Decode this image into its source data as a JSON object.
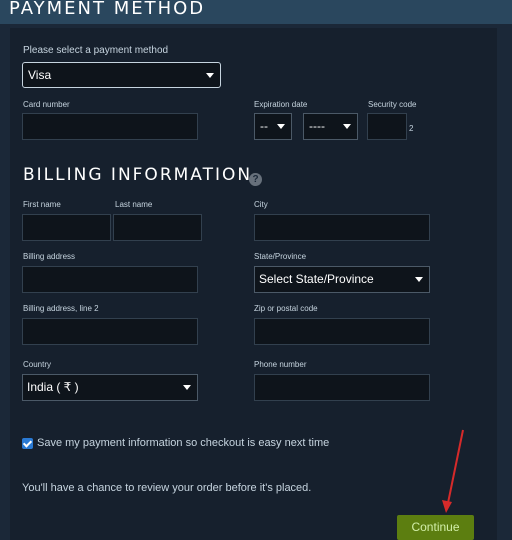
{
  "header": {
    "title": "PAYMENT METHOD"
  },
  "payment": {
    "select_label": "Please select a payment method",
    "method_value": "Visa",
    "card_number_label": "Card number",
    "expiration_label": "Expiration date",
    "exp_month": "--",
    "exp_year": "----",
    "security_code_label": "Security code",
    "security_hint": "2"
  },
  "billing": {
    "title": "BILLING INFORMATION",
    "help_icon": "?",
    "first_name_label": "First name",
    "last_name_label": "Last name",
    "city_label": "City",
    "address_label": "Billing address",
    "state_label": "State/Province",
    "state_value": "Select State/Province",
    "address2_label": "Billing address, line 2",
    "zip_label": "Zip or postal code",
    "country_label": "Country",
    "country_value": "India ( ₹ )",
    "phone_label": "Phone number"
  },
  "save_info": {
    "checked": true,
    "label": "Save my payment information so checkout is easy next time"
  },
  "review_note": "You'll have a chance to review your order before it's placed.",
  "continue_button": "Continue",
  "colors": {
    "background": "#1b2838",
    "panel": "#16202d",
    "continue": "#5c7e10",
    "arrow": "#d62a2a"
  }
}
